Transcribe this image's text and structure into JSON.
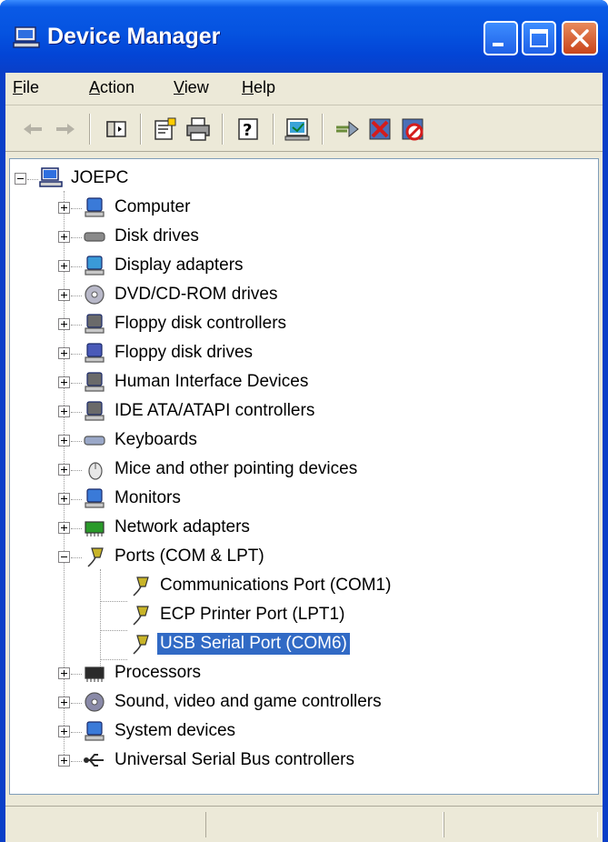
{
  "window": {
    "title": "Device Manager",
    "app_icon": "computer-monitor-icon",
    "controls": [
      "minimize-icon",
      "maximize-icon",
      "close-icon"
    ]
  },
  "menu": {
    "file": {
      "mnemonic": "F",
      "rest": "ile"
    },
    "action": {
      "mnemonic": "A",
      "rest": "ction"
    },
    "view": {
      "mnemonic": "V",
      "rest": "iew"
    },
    "help": {
      "mnemonic": "H",
      "rest": "elp"
    }
  },
  "toolbar": {
    "buttons": [
      "back-arrow-icon",
      "forward-arrow-icon",
      "show-hide-console-tree-icon",
      "properties-icon",
      "print-icon",
      "help-icon",
      "scan-hardware-changes-icon",
      "update-driver-icon",
      "uninstall-icon",
      "disable-icon"
    ]
  },
  "tree": {
    "root": "JOEPC",
    "categories": [
      {
        "label": "Computer",
        "icon": "computer-icon"
      },
      {
        "label": "Disk drives",
        "icon": "disk-drive-icon"
      },
      {
        "label": "Display adapters",
        "icon": "display-adapter-icon"
      },
      {
        "label": "DVD/CD-ROM drives",
        "icon": "cdrom-icon"
      },
      {
        "label": "Floppy disk controllers",
        "icon": "floppy-controller-icon"
      },
      {
        "label": "Floppy disk drives",
        "icon": "floppy-drive-icon"
      },
      {
        "label": "Human Interface Devices",
        "icon": "hid-icon"
      },
      {
        "label": "IDE ATA/ATAPI controllers",
        "icon": "ide-controller-icon"
      },
      {
        "label": "Keyboards",
        "icon": "keyboard-icon"
      },
      {
        "label": "Mice and other pointing devices",
        "icon": "mouse-icon"
      },
      {
        "label": "Monitors",
        "icon": "monitor-icon"
      },
      {
        "label": "Network adapters",
        "icon": "network-adapter-icon"
      },
      {
        "label": "Ports (COM & LPT)",
        "icon": "port-icon",
        "expanded": true,
        "children": [
          {
            "label": "Communications Port (COM1)",
            "icon": "port-icon"
          },
          {
            "label": "ECP Printer Port (LPT1)",
            "icon": "port-icon"
          },
          {
            "label": "USB Serial Port (COM6)",
            "icon": "port-icon",
            "selected": true
          }
        ]
      },
      {
        "label": "Processors",
        "icon": "processor-icon"
      },
      {
        "label": "Sound, video and game controllers",
        "icon": "sound-icon"
      },
      {
        "label": "System devices",
        "icon": "system-device-icon"
      },
      {
        "label": "Universal Serial Bus controllers",
        "icon": "usb-icon"
      }
    ]
  },
  "colors": {
    "title_blue": "#0553e0",
    "selection": "#316ac5",
    "chrome": "#ece9d8"
  }
}
